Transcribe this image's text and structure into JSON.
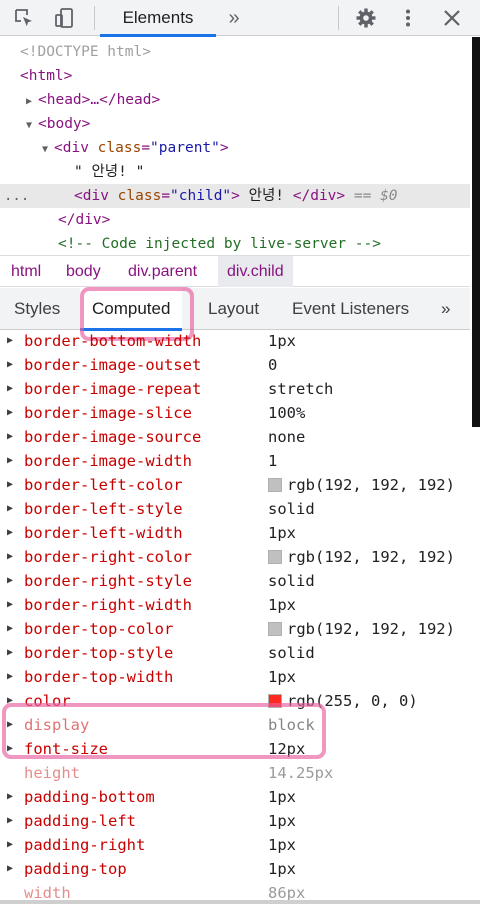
{
  "toolbar": {
    "active_tab": "Elements",
    "more_tabs": "»",
    "icons": [
      "inspect-element-icon",
      "device-toolbar-icon",
      "settings-gear-icon",
      "kebab-menu-icon",
      "close-icon"
    ]
  },
  "dom_tree": {
    "doctype": "<!DOCTYPE html>",
    "html_open": "<html>",
    "head_collapsed": "<head>…</head>",
    "body_open": "<body>",
    "div_parent_tag": "<div ",
    "div_parent_attr": "class",
    "div_parent_value": "\"parent\"",
    "div_parent_close": ">",
    "text_node": "\" 안녕! \"",
    "child_tag_open": "<div ",
    "child_attr": "class",
    "child_value": "\"child\"",
    "child_tag_close": ">",
    "child_text": " 안녕! ",
    "child_end_tag": "</div>",
    "selected_marker": " == $0",
    "ellipsis": "...",
    "div_close": "</div>",
    "comment": "<!-- Code injected by live-server -->"
  },
  "breadcrumbs": [
    {
      "tag": "html",
      "cls": ""
    },
    {
      "tag": "body",
      "cls": ""
    },
    {
      "tag": "div",
      "cls": ".parent"
    },
    {
      "tag": "div",
      "cls": ".child"
    }
  ],
  "subtabs": {
    "styles": "Styles",
    "computed": "Computed",
    "layout": "Layout",
    "event_listeners": "Event Listeners",
    "more": "»"
  },
  "computed_properties": [
    {
      "name": "border-bottom-width",
      "value": "1px",
      "state": "clipped"
    },
    {
      "name": "border-image-outset",
      "value": "0",
      "state": "normal"
    },
    {
      "name": "border-image-repeat",
      "value": "stretch",
      "state": "normal"
    },
    {
      "name": "border-image-slice",
      "value": "100%",
      "state": "normal"
    },
    {
      "name": "border-image-source",
      "value": "none",
      "state": "normal"
    },
    {
      "name": "border-image-width",
      "value": "1",
      "state": "normal"
    },
    {
      "name": "border-left-color",
      "value": "rgb(192, 192, 192)",
      "swatch": "#c0c0c0",
      "state": "normal"
    },
    {
      "name": "border-left-style",
      "value": "solid",
      "state": "normal"
    },
    {
      "name": "border-left-width",
      "value": "1px",
      "state": "normal"
    },
    {
      "name": "border-right-color",
      "value": "rgb(192, 192, 192)",
      "swatch": "#c0c0c0",
      "state": "normal"
    },
    {
      "name": "border-right-style",
      "value": "solid",
      "state": "normal"
    },
    {
      "name": "border-right-width",
      "value": "1px",
      "state": "normal"
    },
    {
      "name": "border-top-color",
      "value": "rgb(192, 192, 192)",
      "swatch": "#c0c0c0",
      "state": "normal"
    },
    {
      "name": "border-top-style",
      "value": "solid",
      "state": "normal"
    },
    {
      "name": "border-top-width",
      "value": "1px",
      "state": "normal"
    },
    {
      "name": "color",
      "value": "rgb(255, 0, 0)",
      "swatch": "#ff2a1f",
      "state": "normal"
    },
    {
      "name": "display",
      "value": "block",
      "state": "partial"
    },
    {
      "name": "font-size",
      "value": "12px",
      "state": "normal"
    },
    {
      "name": "height",
      "value": "14.25px",
      "state": "inherited"
    },
    {
      "name": "padding-bottom",
      "value": "1px",
      "state": "normal"
    },
    {
      "name": "padding-left",
      "value": "1px",
      "state": "normal"
    },
    {
      "name": "padding-right",
      "value": "1px",
      "state": "normal"
    },
    {
      "name": "padding-top",
      "value": "1px",
      "state": "normal"
    },
    {
      "name": "width",
      "value": "86px",
      "state": "inherited"
    }
  ],
  "colors": {
    "accent": "#1a73e8",
    "highlight_annotation": "#e85fa0",
    "property_name": "#c80000",
    "tag": "#881280"
  }
}
